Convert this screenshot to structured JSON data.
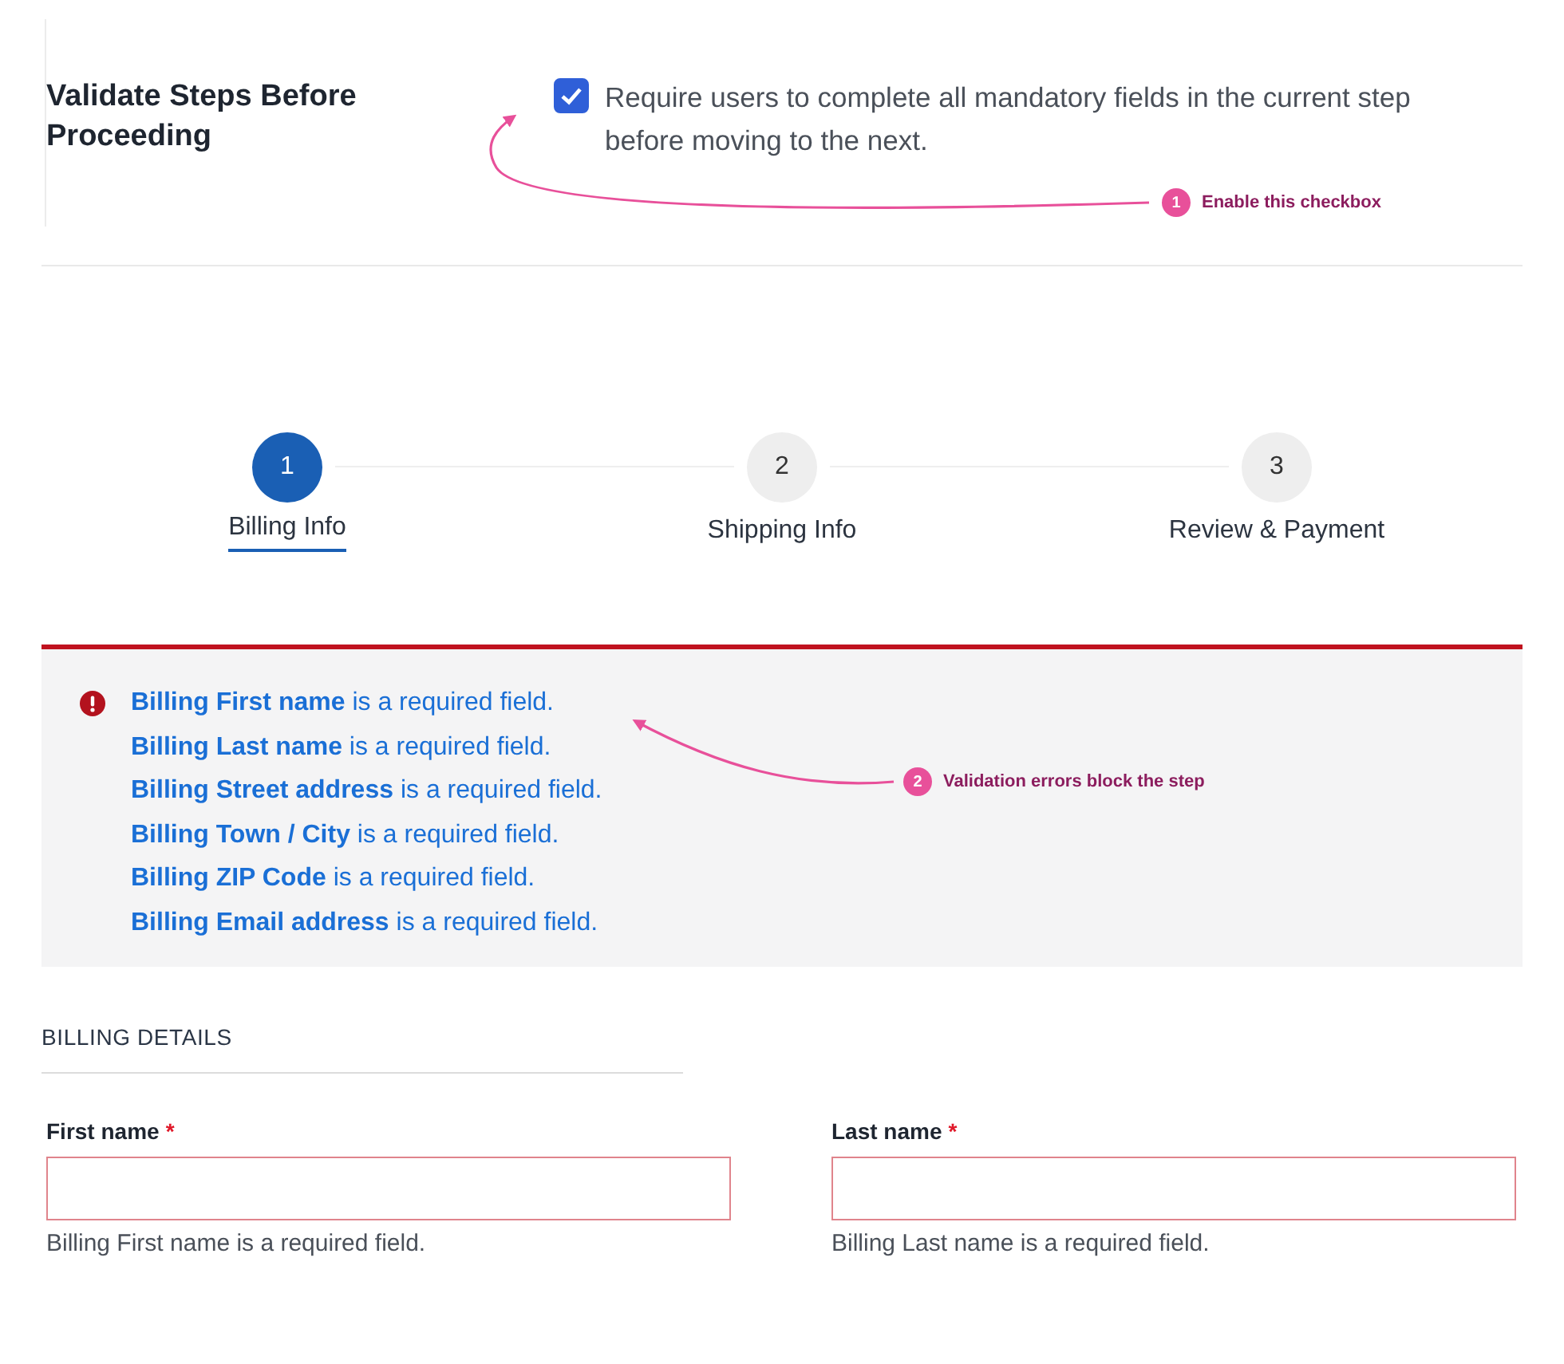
{
  "setting": {
    "title": "Validate Steps Before Proceeding",
    "checkbox": {
      "checked": true,
      "label": "Require users to complete all mandatory fields in the current step before moving to the next."
    }
  },
  "steps": [
    {
      "number": "1",
      "label": "Billing Info",
      "selected": true
    },
    {
      "number": "2",
      "label": "Shipping Info",
      "selected": false
    },
    {
      "number": "3",
      "label": "Review & Payment",
      "selected": false
    }
  ],
  "errors": [
    "**Billing First name** is a required field.",
    "**Billing Last name** is a required field.",
    "**Billing Street address** is a required field.",
    "**Billing Town / City** is a required field.",
    "**Billing ZIP Code** is a required field.",
    "**Billing Email address** is a required field."
  ],
  "section_title": "BILLING DETAILS",
  "fields": [
    {
      "label": "First name",
      "required_mark": "*",
      "invalid": true,
      "error": "Billing First name is a required field."
    },
    {
      "label": "Last name",
      "required_mark": "*",
      "invalid": true,
      "error": "Billing Last name is a required field."
    }
  ],
  "annotations": [
    {
      "number": "1",
      "text": "Enable this checkbox"
    },
    {
      "number": "2",
      "text": "Validation errors block the step"
    }
  ]
}
